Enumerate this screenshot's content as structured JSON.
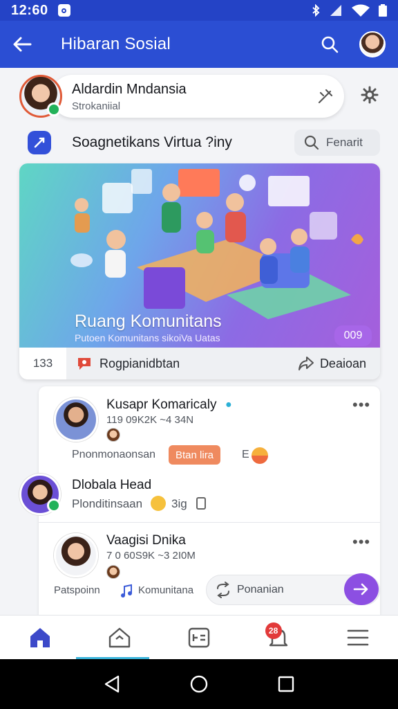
{
  "status": {
    "time": "12:60"
  },
  "app_bar": {
    "title": "Hibaran Sosial"
  },
  "profile": {
    "name": "Aldardin Mndansia",
    "subtitle": "Strokaniial"
  },
  "section": {
    "title": "Soagnetikans  Virtua ?iny",
    "search_label": "Fenarit"
  },
  "hero": {
    "title": "Ruang Komunitans",
    "subtitle": "Putoen Komunitans sikoiVa Uatas",
    "count": "009",
    "number": "133",
    "action_label": "Rogpianidbtan",
    "share_label": "Deaioan"
  },
  "posts": [
    {
      "name": "Kusapr Komaricaly",
      "meta": "119 09K2K ~4 34N",
      "hint": "Pnonmonaonsan",
      "tag": "Btan lira",
      "extra": "E"
    },
    {
      "name": "Dlobala Head",
      "meta": "Plonditinsaan",
      "extra": "3ig"
    },
    {
      "name": "Vaagisi Dnika",
      "meta": "7 0 60S9K ~3 2I0M",
      "hint": "Patspoinn",
      "community": "Komunitana"
    }
  ],
  "reply": {
    "placeholder": "Ponanian"
  },
  "colors": {
    "primary": "#2b4ed3",
    "accent": "#8c4fe2",
    "tag": "#ef8a5f",
    "online": "#23b25a"
  },
  "nav": {
    "badge": "28"
  },
  "icons": [
    "back-arrow-icon",
    "search-icon",
    "edit-icon",
    "gear-icon",
    "home-icon",
    "community-icon",
    "post-icon",
    "bell-icon",
    "menu-icon"
  ]
}
